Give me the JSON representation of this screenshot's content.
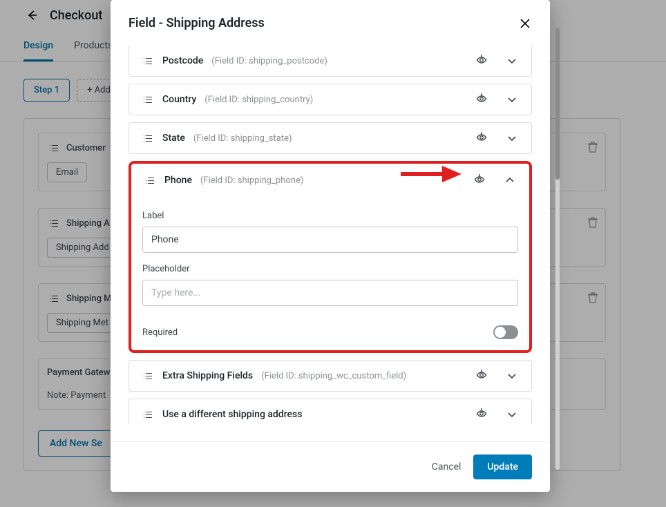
{
  "bg": {
    "pageTitle": "Checkout",
    "tabs": {
      "design": "Design",
      "products": "Products"
    },
    "step1": "Step 1",
    "addStep": "+ Add",
    "addNew": "Add New Se",
    "sections": {
      "customer": {
        "title": "Customer",
        "pill": "Email"
      },
      "shippingAddr": {
        "title": "Shipping A",
        "pill": "Shipping Add"
      },
      "shippingMeth": {
        "title": "Shipping M",
        "pill": "Shipping Met"
      },
      "payment": {
        "title": "Payment Gatew",
        "note": "Note: Payment"
      }
    }
  },
  "modal": {
    "title": "Field - Shipping Address",
    "cancel": "Cancel",
    "update": "Update",
    "rows": {
      "postcode": {
        "name": "Postcode",
        "id": "(Field ID: shipping_postcode)"
      },
      "country": {
        "name": "Country",
        "id": "(Field ID: shipping_country)"
      },
      "state": {
        "name": "State",
        "id": "(Field ID: shipping_state)"
      },
      "phone": {
        "name": "Phone",
        "id": "(Field ID: shipping_phone)"
      },
      "extra": {
        "name": "Extra Shipping Fields",
        "id": "(Field ID: shipping_wc_custom_field)"
      },
      "different": {
        "name": "Use a different shipping address"
      }
    },
    "form": {
      "labelLabel": "Label",
      "labelValue": "Phone",
      "placeholderLabel": "Placeholder",
      "placeholderHint": "Type here...",
      "requiredLabel": "Required"
    }
  }
}
